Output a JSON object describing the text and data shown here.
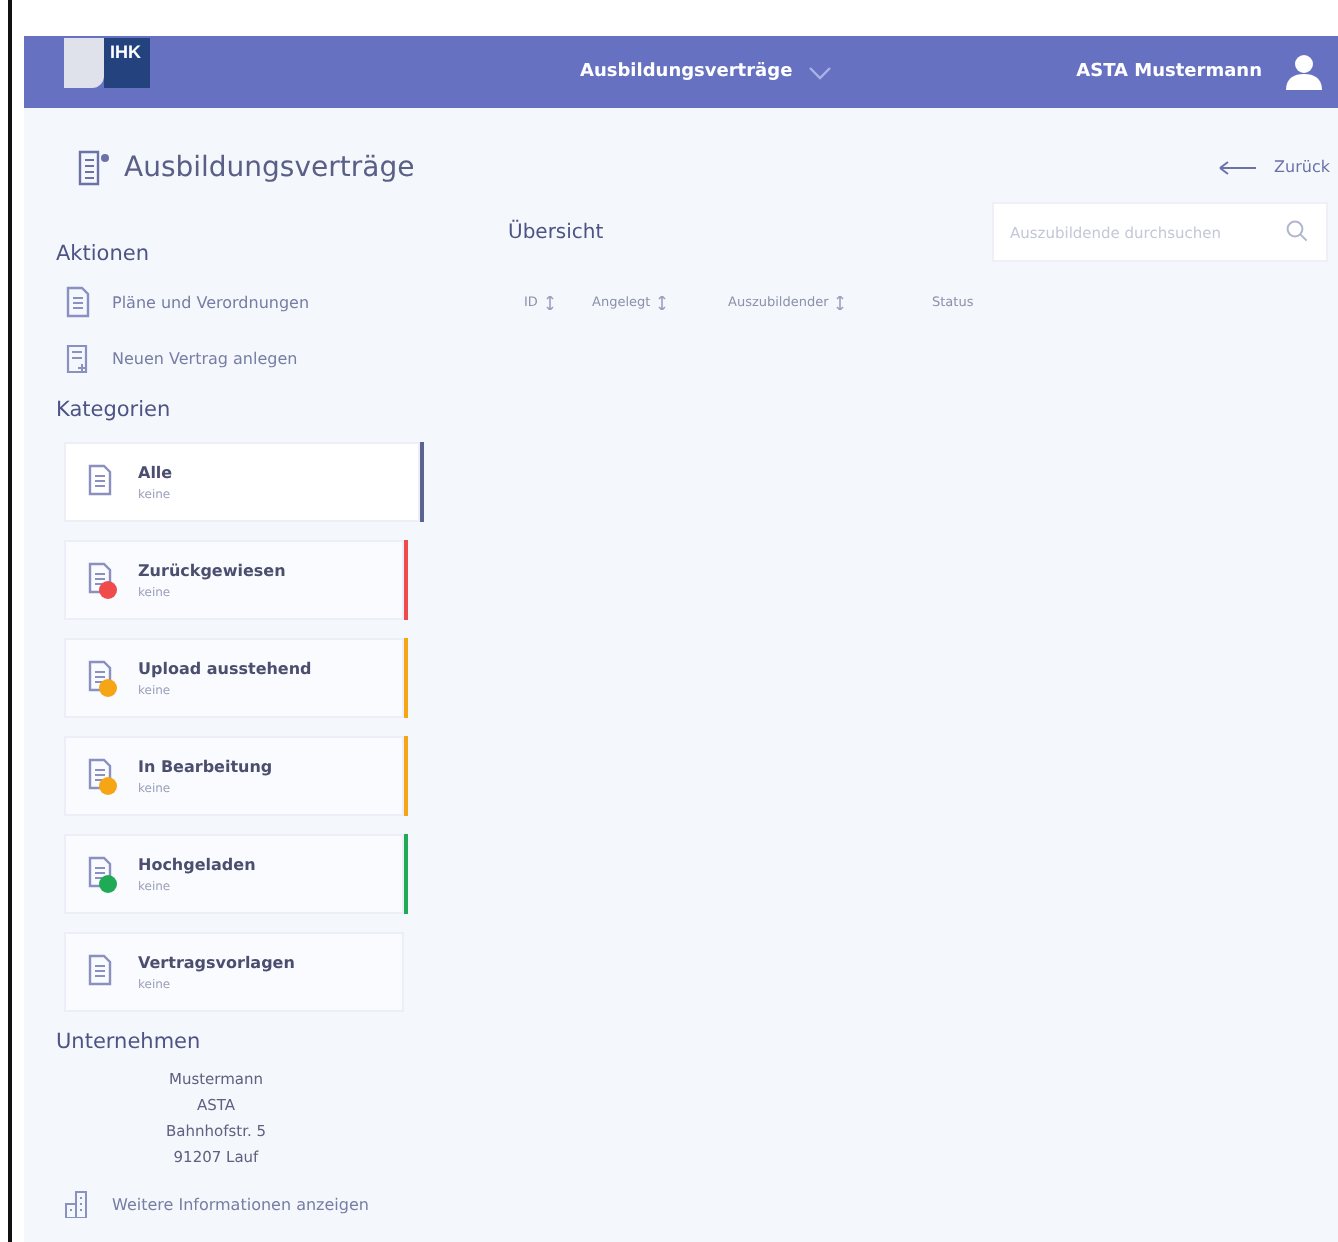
{
  "header": {
    "logo": "IHK",
    "nav": "Ausbildungsverträge",
    "user": "ASTA Mustermann"
  },
  "page": {
    "title": "Ausbildungsverträge",
    "back": "Zurück"
  },
  "actions": {
    "heading": "Aktionen",
    "items": [
      {
        "label": "Pläne und Verordnungen",
        "kind": "document"
      },
      {
        "label": "Neuen Vertrag anlegen",
        "kind": "new"
      }
    ]
  },
  "categories": {
    "heading": "Kategorien",
    "items": [
      {
        "label": "Alle",
        "count": "keine",
        "kind": "all",
        "selected": true,
        "color": "#5b6392"
      },
      {
        "label": "Zurückgewiesen",
        "count": "keine",
        "kind": "status",
        "selected": false,
        "color": "#ef4b4b"
      },
      {
        "label": "Upload ausstehend",
        "count": "keine",
        "kind": "status",
        "selected": false,
        "color": "#f5a515"
      },
      {
        "label": "In Bearbeitung",
        "count": "keine",
        "kind": "status",
        "selected": false,
        "color": "#f5a515"
      },
      {
        "label": "Hochgeladen",
        "count": "keine",
        "kind": "status",
        "selected": false,
        "color": "#1faa55"
      },
      {
        "label": "Vertragsvorlagen",
        "count": "keine",
        "kind": "templates",
        "selected": false
      }
    ]
  },
  "company": {
    "heading": "Unternehmen",
    "lines": [
      "Mustermann",
      "ASTA",
      "Bahnhofstr. 5",
      "91207 Lauf"
    ],
    "link": "Weitere Informationen anzeigen"
  },
  "overview": {
    "title": "Übersicht",
    "search": {
      "placeholder": "Auszubildende durchsuchen"
    },
    "columns": [
      {
        "label": "ID",
        "sortable": true
      },
      {
        "label": "Angelegt",
        "sortable": true
      },
      {
        "label": "Auszubildender",
        "sortable": true
      },
      {
        "label": "Status",
        "sortable": false
      }
    ]
  }
}
